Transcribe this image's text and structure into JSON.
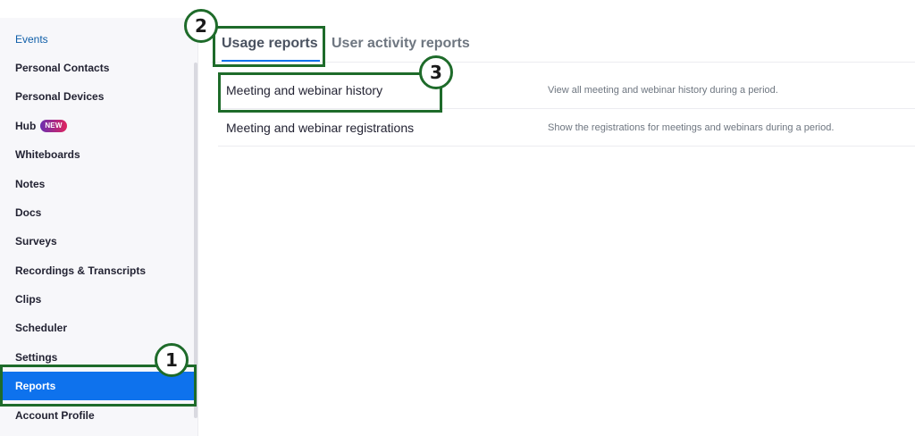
{
  "sidebar": {
    "items": [
      {
        "label": "Events"
      },
      {
        "label": "Personal Contacts"
      },
      {
        "label": "Personal Devices"
      },
      {
        "label": "Hub",
        "badge": "NEW"
      },
      {
        "label": "Whiteboards"
      },
      {
        "label": "Notes"
      },
      {
        "label": "Docs"
      },
      {
        "label": "Surveys"
      },
      {
        "label": "Recordings & Transcripts"
      },
      {
        "label": "Clips"
      },
      {
        "label": "Scheduler"
      },
      {
        "label": "Settings"
      },
      {
        "label": "Reports",
        "active": true
      },
      {
        "label": "Account Profile"
      }
    ]
  },
  "tabs": [
    {
      "label": "Usage reports",
      "active": true
    },
    {
      "label": "User activity reports"
    }
  ],
  "reports": [
    {
      "title": "Meeting and webinar history",
      "description": "View all meeting and webinar history during a period."
    },
    {
      "title": "Meeting and webinar registrations",
      "description": "Show the registrations for meetings and webinars during a period."
    }
  ],
  "annotations": [
    {
      "number": "1",
      "target": "Reports"
    },
    {
      "number": "2",
      "target": "Usage reports"
    },
    {
      "number": "3",
      "target": "Meeting and webinar history"
    }
  ],
  "colors": {
    "accent": "#0e72ed",
    "annotation": "#1e6b2a",
    "link": "#0e5ea8",
    "badge_start": "#6a2fb0",
    "badge_end": "#e0245e"
  }
}
